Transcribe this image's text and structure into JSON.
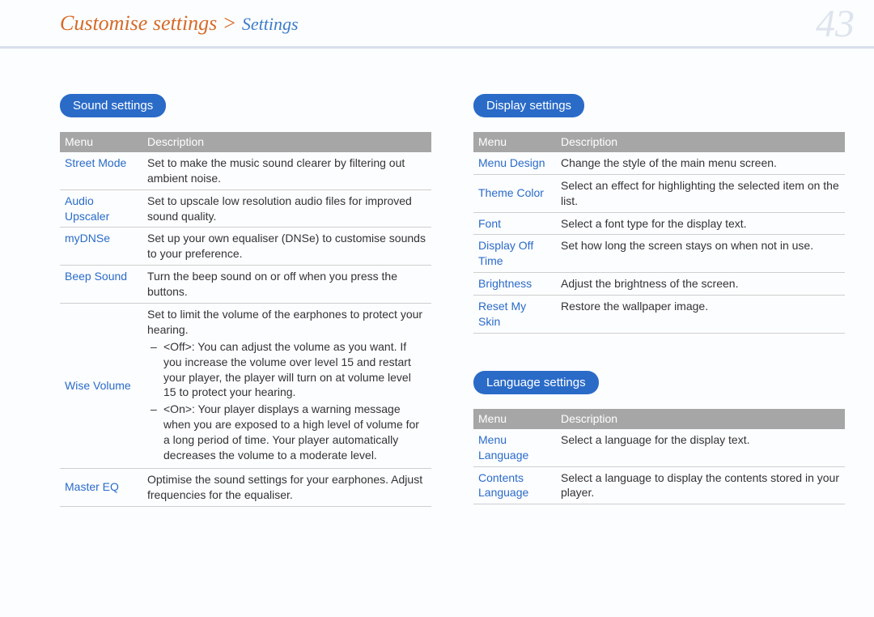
{
  "header": {
    "breadcrumb_main": "Customise settings > ",
    "breadcrumb_sub": "Settings",
    "page_number": "43"
  },
  "tableHeader": {
    "menu": "Menu",
    "description": "Description"
  },
  "left": {
    "sound": {
      "title": "Sound settings",
      "rows": {
        "r0": {
          "menu": "Street Mode",
          "desc": "Set to make the music sound clearer by filtering out ambient noise."
        },
        "r1": {
          "menu": "Audio Upscaler",
          "desc": "Set to upscale low resolution audio files for improved sound quality."
        },
        "r2": {
          "menu": "myDNSe",
          "desc": "Set up your own equaliser (DNSe) to customise sounds to your preference."
        },
        "r3": {
          "menu": "Beep Sound",
          "desc": "Turn the beep sound on or off when you press the buttons."
        },
        "r4": {
          "menu": "Wise Volume",
          "intro": "Set to limit the volume of the earphones to protect your hearing.",
          "opt_off": "<Off>: You can adjust the volume as you want. If you increase the volume over level 15 and restart your player, the player will turn on at volume level 15 to protect your hearing.",
          "opt_on": "<On>: Your player displays a warning message when you are exposed to a high level of volume for a long period of time. Your player automatically decreases the volume to a moderate level."
        },
        "r5": {
          "menu": "Master EQ",
          "desc": "Optimise the sound settings for your earphones. Adjust frequencies for the equaliser."
        }
      }
    }
  },
  "right": {
    "display": {
      "title": "Display settings",
      "rows": {
        "r0": {
          "menu": "Menu Design",
          "desc": "Change the style of the main menu screen."
        },
        "r1": {
          "menu": "Theme Color",
          "desc": "Select an effect for highlighting the selected item on the list."
        },
        "r2": {
          "menu": "Font",
          "desc": "Select a font type for the display text."
        },
        "r3": {
          "menu": "Display Off Time",
          "desc": "Set how long the screen stays on when not in use."
        },
        "r4": {
          "menu": "Brightness",
          "desc": "Adjust the brightness of the screen."
        },
        "r5": {
          "menu": "Reset My Skin",
          "desc": "Restore the wallpaper image."
        }
      }
    },
    "language": {
      "title": "Language settings",
      "rows": {
        "r0": {
          "menu": "Menu Language",
          "desc": "Select a language for the display text."
        },
        "r1": {
          "menu": "Contents Language",
          "desc": "Select a language to display the contents stored in your player."
        }
      }
    }
  }
}
